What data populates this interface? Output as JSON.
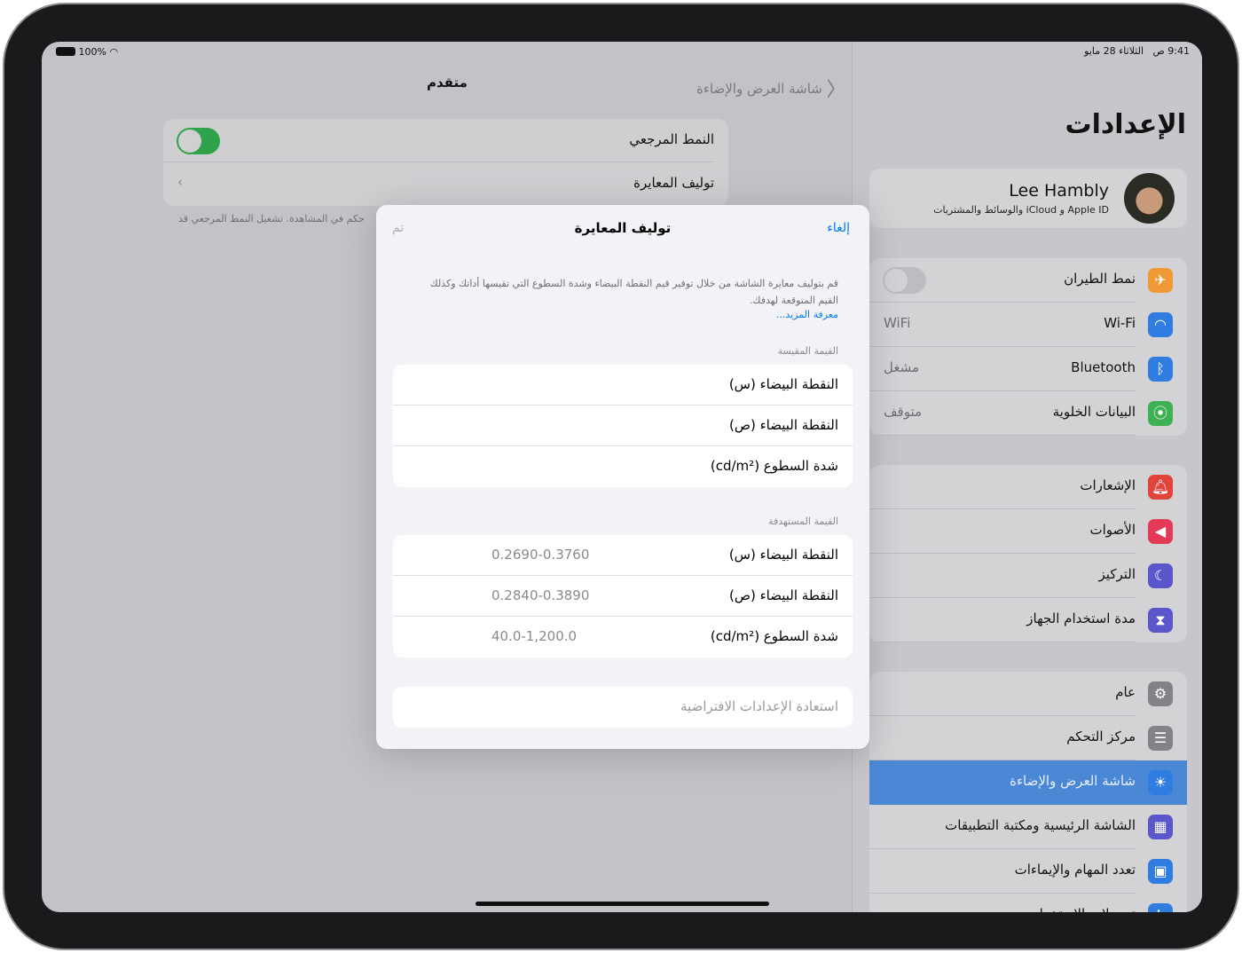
{
  "status": {
    "battery": "100%",
    "time": "9:41 ص",
    "date": "الثلاثاء 28 مايو"
  },
  "detail": {
    "back_label": "شاشة العرض والإضاءة",
    "title": "متقدم",
    "rows": [
      {
        "label": "النمط المرجعي",
        "toggle": true
      },
      {
        "label": "توليف المعايرة"
      }
    ],
    "footer": "حكم في المشاهدة. تشغيل النمط المرجعي قد"
  },
  "sidebar": {
    "title": "الإعدادات",
    "profile": {
      "name": "Lee Hambly",
      "subtitle": "Apple ID و iCloud والوسائط والمشتريات"
    },
    "group1": [
      {
        "label": "نمط الطيران",
        "icon": "airplane-icon",
        "color": "#ef9a36",
        "toggle": false
      },
      {
        "label": "Wi-Fi",
        "value": "WiFi",
        "icon": "wifi-icon",
        "color": "#2f7de0"
      },
      {
        "label": "Bluetooth",
        "value": "مشغل",
        "icon": "bluetooth-icon",
        "color": "#2f7de0"
      },
      {
        "label": "البيانات الخلوية",
        "value": "متوقف",
        "icon": "antenna-icon",
        "color": "#3fb155"
      }
    ],
    "group2": [
      {
        "label": "الإشعارات",
        "icon": "bell-icon",
        "color": "#e0443a"
      },
      {
        "label": "الأصوات",
        "icon": "speaker-icon",
        "color": "#e33b55"
      },
      {
        "label": "التركيز",
        "icon": "moon-icon",
        "color": "#5b56c9"
      },
      {
        "label": "مدة استخدام الجهاز",
        "icon": "hourglass-icon",
        "color": "#5b56c9"
      }
    ],
    "group3": [
      {
        "label": "عام",
        "icon": "gear-icon",
        "color": "#838387"
      },
      {
        "label": "مركز التحكم",
        "icon": "switches-icon",
        "color": "#838387"
      },
      {
        "label": "شاشة العرض والإضاءة",
        "icon": "sun-icon",
        "color": "#2f7de0",
        "selected": true
      },
      {
        "label": "الشاشة الرئيسية ومكتبة التطبيقات",
        "icon": "grid-icon",
        "color": "#5b56c9"
      },
      {
        "label": "تعدد المهام والإيماءات",
        "icon": "multitask-icon",
        "color": "#2f7de0"
      },
      {
        "label": "تسهيلات الاستخدام",
        "icon": "accessibility-icon",
        "color": "#2f7de0"
      }
    ],
    "selected_color": "#4a88d6"
  },
  "modal": {
    "cancel": "إلغاء",
    "title": "توليف المعايرة",
    "done": "تم",
    "description": "قم بتوليف معايرة الشاشة من خلال توفير قيم النقطة البيضاء وشدة السطوع التي تقيسها أداتك وكذلك القيم المتوقعة لهدفك.",
    "learn_more": "معرفة المزيد...",
    "measured_header": "القيمة المقيسة",
    "measured": [
      {
        "label": "النقطة البيضاء (س)"
      },
      {
        "label": "النقطة البيضاء (ص)"
      },
      {
        "label": "شدة السطوع (cd/m²)"
      }
    ],
    "target_header": "القيمة المستهدفة",
    "target": [
      {
        "label": "النقطة البيضاء (س)",
        "value": "0.2690-0.3760"
      },
      {
        "label": "النقطة البيضاء (ص)",
        "value": "0.2840-0.3890"
      },
      {
        "label": "شدة السطوع (cd/m²)",
        "value": "40.0-1,200.0"
      }
    ],
    "restore": "استعادة الإعدادات الافتراضية",
    "accent": "#007aff"
  }
}
